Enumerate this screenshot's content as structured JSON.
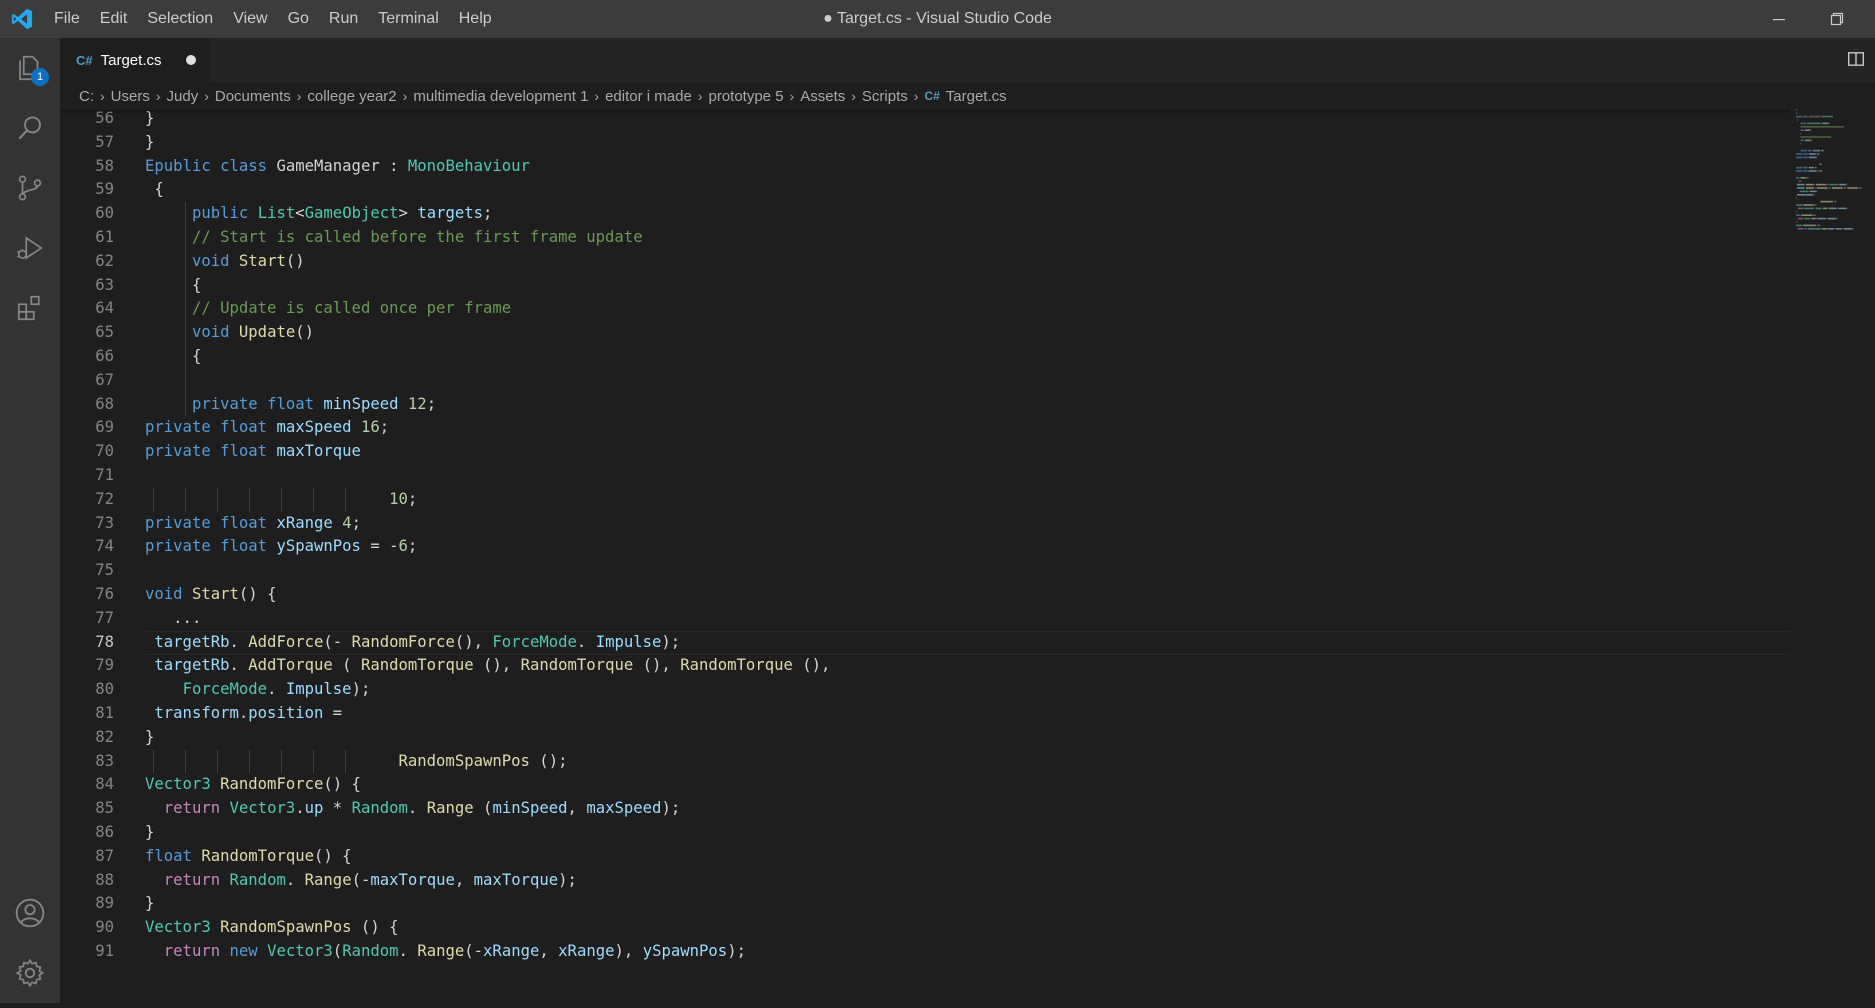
{
  "window": {
    "title": "● Target.cs - Visual Studio Code"
  },
  "menu": [
    "File",
    "Edit",
    "Selection",
    "View",
    "Go",
    "Run",
    "Terminal",
    "Help"
  ],
  "activity_bar": {
    "explorer_badge": "1"
  },
  "tab": {
    "label": "Target.cs",
    "icon": "C#"
  },
  "breadcrumb": [
    "C:",
    "Users",
    "Judy",
    "Documents",
    "college year2",
    "multimedia development 1",
    "editor i made",
    "prototype 5",
    "Assets",
    "Scripts",
    "Target.cs"
  ],
  "editor": {
    "active_line": "78",
    "lines": [
      {
        "n": "56",
        "tokens": [
          [
            "p",
            "}"
          ]
        ]
      },
      {
        "n": "57",
        "tokens": [
          [
            "p",
            "}"
          ]
        ]
      },
      {
        "n": "58",
        "tokens": [
          [
            "k",
            "Epublic"
          ],
          [
            "p",
            " "
          ],
          [
            "k",
            "class"
          ],
          [
            "p",
            " GameManager : "
          ],
          [
            "t",
            "MonoBehaviour"
          ]
        ]
      },
      {
        "n": "59",
        "tokens": [
          [
            "p",
            " {"
          ]
        ]
      },
      {
        "n": "60",
        "tokens": [
          [
            "p",
            "     "
          ],
          [
            "k",
            "public"
          ],
          [
            "p",
            " "
          ],
          [
            "t",
            "List"
          ],
          [
            "p",
            "<"
          ],
          [
            "t",
            "GameObject"
          ],
          [
            "p",
            "> "
          ],
          [
            "v",
            "targets"
          ],
          [
            "p",
            ";"
          ]
        ]
      },
      {
        "n": "61",
        "tokens": [
          [
            "p",
            "     "
          ],
          [
            "c",
            "// Start is called before the first frame update"
          ]
        ]
      },
      {
        "n": "62",
        "tokens": [
          [
            "p",
            "     "
          ],
          [
            "k",
            "void"
          ],
          [
            "p",
            " "
          ],
          [
            "f",
            "Start"
          ],
          [
            "p",
            "()"
          ]
        ]
      },
      {
        "n": "63",
        "tokens": [
          [
            "p",
            "     {"
          ]
        ]
      },
      {
        "n": "64",
        "tokens": [
          [
            "p",
            "     "
          ],
          [
            "c",
            "// Update is called once per frame"
          ]
        ]
      },
      {
        "n": "65",
        "tokens": [
          [
            "p",
            "     "
          ],
          [
            "k",
            "void"
          ],
          [
            "p",
            " "
          ],
          [
            "f",
            "Update"
          ],
          [
            "p",
            "()"
          ]
        ]
      },
      {
        "n": "66",
        "tokens": [
          [
            "p",
            "     {"
          ]
        ]
      },
      {
        "n": "67",
        "tokens": []
      },
      {
        "n": "68",
        "tokens": [
          [
            "p",
            "     "
          ],
          [
            "k",
            "private"
          ],
          [
            "p",
            " "
          ],
          [
            "k",
            "float"
          ],
          [
            "p",
            " "
          ],
          [
            "v",
            "minSpeed"
          ],
          [
            "p",
            " "
          ],
          [
            "n",
            "12"
          ],
          [
            "p",
            ";"
          ]
        ]
      },
      {
        "n": "69",
        "tokens": [
          [
            "k",
            "private"
          ],
          [
            "p",
            " "
          ],
          [
            "k",
            "float"
          ],
          [
            "p",
            " "
          ],
          [
            "v",
            "maxSpeed"
          ],
          [
            "p",
            " "
          ],
          [
            "n",
            "16"
          ],
          [
            "p",
            ";"
          ]
        ]
      },
      {
        "n": "70",
        "tokens": [
          [
            "k",
            "private"
          ],
          [
            "p",
            " "
          ],
          [
            "k",
            "float"
          ],
          [
            "p",
            " "
          ],
          [
            "v",
            "maxTorque"
          ]
        ]
      },
      {
        "n": "71",
        "tokens": []
      },
      {
        "n": "72",
        "tokens": [
          [
            "p",
            "                          "
          ],
          [
            "n",
            "10"
          ],
          [
            "p",
            ";"
          ]
        ]
      },
      {
        "n": "73",
        "tokens": [
          [
            "k",
            "private"
          ],
          [
            "p",
            " "
          ],
          [
            "k",
            "float"
          ],
          [
            "p",
            " "
          ],
          [
            "v",
            "xRange"
          ],
          [
            "p",
            " "
          ],
          [
            "n",
            "4"
          ],
          [
            "p",
            ";"
          ]
        ]
      },
      {
        "n": "74",
        "tokens": [
          [
            "k",
            "private"
          ],
          [
            "p",
            " "
          ],
          [
            "k",
            "float"
          ],
          [
            "p",
            " "
          ],
          [
            "v",
            "ySpawnPos"
          ],
          [
            "p",
            " = -"
          ],
          [
            "n",
            "6"
          ],
          [
            "p",
            ";"
          ]
        ]
      },
      {
        "n": "75",
        "tokens": []
      },
      {
        "n": "76",
        "tokens": [
          [
            "k",
            "void"
          ],
          [
            "p",
            " "
          ],
          [
            "f",
            "Start"
          ],
          [
            "p",
            "() {"
          ]
        ]
      },
      {
        "n": "77",
        "tokens": [
          [
            "p",
            "   ..."
          ]
        ]
      },
      {
        "n": "78",
        "tokens": [
          [
            "p",
            " "
          ],
          [
            "v",
            "targetRb"
          ],
          [
            "p",
            ". "
          ],
          [
            "f",
            "AddForce"
          ],
          [
            "p",
            "(- "
          ],
          [
            "f",
            "RandomForce"
          ],
          [
            "p",
            "(), "
          ],
          [
            "t",
            "ForceMode"
          ],
          [
            "p",
            ". "
          ],
          [
            "v",
            "Impulse"
          ],
          [
            "p",
            ");"
          ]
        ]
      },
      {
        "n": "79",
        "tokens": [
          [
            "p",
            " "
          ],
          [
            "v",
            "targetRb"
          ],
          [
            "p",
            ". "
          ],
          [
            "f",
            "AddTorque"
          ],
          [
            "p",
            " ( "
          ],
          [
            "f",
            "RandomTorque"
          ],
          [
            "p",
            " (), "
          ],
          [
            "f",
            "RandomTorque"
          ],
          [
            "p",
            " (), "
          ],
          [
            "f",
            "RandomTorque"
          ],
          [
            "p",
            " (),"
          ]
        ]
      },
      {
        "n": "80",
        "tokens": [
          [
            "p",
            "    "
          ],
          [
            "t",
            "ForceMode"
          ],
          [
            "p",
            ". "
          ],
          [
            "v",
            "Impulse"
          ],
          [
            "p",
            ");"
          ]
        ]
      },
      {
        "n": "81",
        "tokens": [
          [
            "p",
            " "
          ],
          [
            "v",
            "transform"
          ],
          [
            "p",
            "."
          ],
          [
            "v",
            "position"
          ],
          [
            "p",
            " ="
          ]
        ]
      },
      {
        "n": "82",
        "tokens": [
          [
            "p",
            "}"
          ]
        ]
      },
      {
        "n": "83",
        "tokens": [
          [
            "p",
            "                           "
          ],
          [
            "f",
            "RandomSpawnPos"
          ],
          [
            "p",
            " ();"
          ]
        ]
      },
      {
        "n": "84",
        "tokens": [
          [
            "t",
            "Vector3"
          ],
          [
            "p",
            " "
          ],
          [
            "f",
            "RandomForce"
          ],
          [
            "p",
            "() {"
          ]
        ]
      },
      {
        "n": "85",
        "tokens": [
          [
            "p",
            "  "
          ],
          [
            "r",
            "return"
          ],
          [
            "p",
            " "
          ],
          [
            "t",
            "Vector3"
          ],
          [
            "p",
            "."
          ],
          [
            "v",
            "up"
          ],
          [
            "p",
            " * "
          ],
          [
            "t",
            "Random"
          ],
          [
            "p",
            ". "
          ],
          [
            "f",
            "Range"
          ],
          [
            "p",
            " ("
          ],
          [
            "v",
            "minSpeed"
          ],
          [
            "p",
            ", "
          ],
          [
            "v",
            "maxSpeed"
          ],
          [
            "p",
            ");"
          ]
        ]
      },
      {
        "n": "86",
        "tokens": [
          [
            "p",
            "}"
          ]
        ]
      },
      {
        "n": "87",
        "tokens": [
          [
            "k",
            "float"
          ],
          [
            "p",
            " "
          ],
          [
            "f",
            "RandomTorque"
          ],
          [
            "p",
            "() {"
          ]
        ]
      },
      {
        "n": "88",
        "tokens": [
          [
            "p",
            "  "
          ],
          [
            "r",
            "return"
          ],
          [
            "p",
            " "
          ],
          [
            "t",
            "Random"
          ],
          [
            "p",
            ". "
          ],
          [
            "f",
            "Range"
          ],
          [
            "p",
            "(-"
          ],
          [
            "v",
            "maxTorque"
          ],
          [
            "p",
            ", "
          ],
          [
            "v",
            "maxTorque"
          ],
          [
            "p",
            ");"
          ]
        ]
      },
      {
        "n": "89",
        "tokens": [
          [
            "p",
            "}"
          ]
        ]
      },
      {
        "n": "90",
        "tokens": [
          [
            "t",
            "Vector3"
          ],
          [
            "p",
            " "
          ],
          [
            "f",
            "RandomSpawnPos"
          ],
          [
            "p",
            " () {"
          ]
        ]
      },
      {
        "n": "91",
        "tokens": [
          [
            "p",
            "  "
          ],
          [
            "r",
            "return"
          ],
          [
            "p",
            " "
          ],
          [
            "k",
            "new"
          ],
          [
            "p",
            " "
          ],
          [
            "t",
            "Vector3"
          ],
          [
            "p",
            "("
          ],
          [
            "t",
            "Random"
          ],
          [
            "p",
            ". "
          ],
          [
            "f",
            "Range"
          ],
          [
            "p",
            "(-"
          ],
          [
            "v",
            "xRange"
          ],
          [
            "p",
            ", "
          ],
          [
            "v",
            "xRange"
          ],
          [
            "p",
            "), "
          ],
          [
            "v",
            "ySpawnPos"
          ],
          [
            "p",
            ");"
          ]
        ]
      }
    ]
  },
  "colors": {
    "titlebar": "#3c3c3c",
    "activitybar": "#333333",
    "editor_bg": "#1e1e1e",
    "accent": "#0e70c0",
    "keyword": "#569cd6",
    "comment": "#6a9955",
    "type": "#4ec9b0",
    "function": "#dcdcaa",
    "variable": "#9cdcfe",
    "number": "#b5cea8",
    "control": "#c586c0"
  },
  "icons": [
    "vscode-logo-icon",
    "minimize-icon",
    "restore-icon",
    "explorer-icon",
    "search-icon",
    "source-control-icon",
    "run-debug-icon",
    "extensions-icon",
    "account-icon",
    "settings-gear-icon",
    "split-editor-icon",
    "csharp-file-icon",
    "chevron-right-icon"
  ]
}
